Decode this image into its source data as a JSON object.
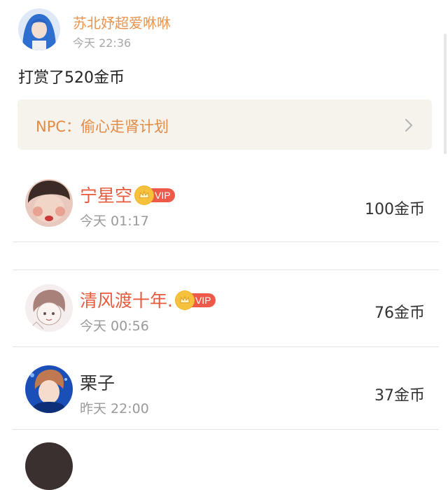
{
  "post": {
    "author_name": "苏北妤超爱咻咻",
    "time": "今天 22:36",
    "reward_text": "打赏了520金币"
  },
  "book_card": {
    "title": "NPC：偷心走肾计划",
    "chevron_icon": "chevron-right-icon"
  },
  "rewards": [
    {
      "name": "宁星空",
      "vip": true,
      "vip_label": "VIP",
      "time": "今天 01:17",
      "amount": "100金币"
    },
    {
      "name": "清风渡十年.",
      "vip": true,
      "vip_label": "VIP",
      "time": "今天 00:56",
      "amount": "76金币"
    },
    {
      "name": "栗子",
      "vip": false,
      "time": "昨天 22:00",
      "amount": "37金币"
    }
  ],
  "colors": {
    "author": "#e8944f",
    "book_title": "#e38b45",
    "card_bg": "#f5f3ec",
    "vip_name": "#e85a3c",
    "vip_badge": "#ed5a4a",
    "crown": "#f6c23e"
  }
}
